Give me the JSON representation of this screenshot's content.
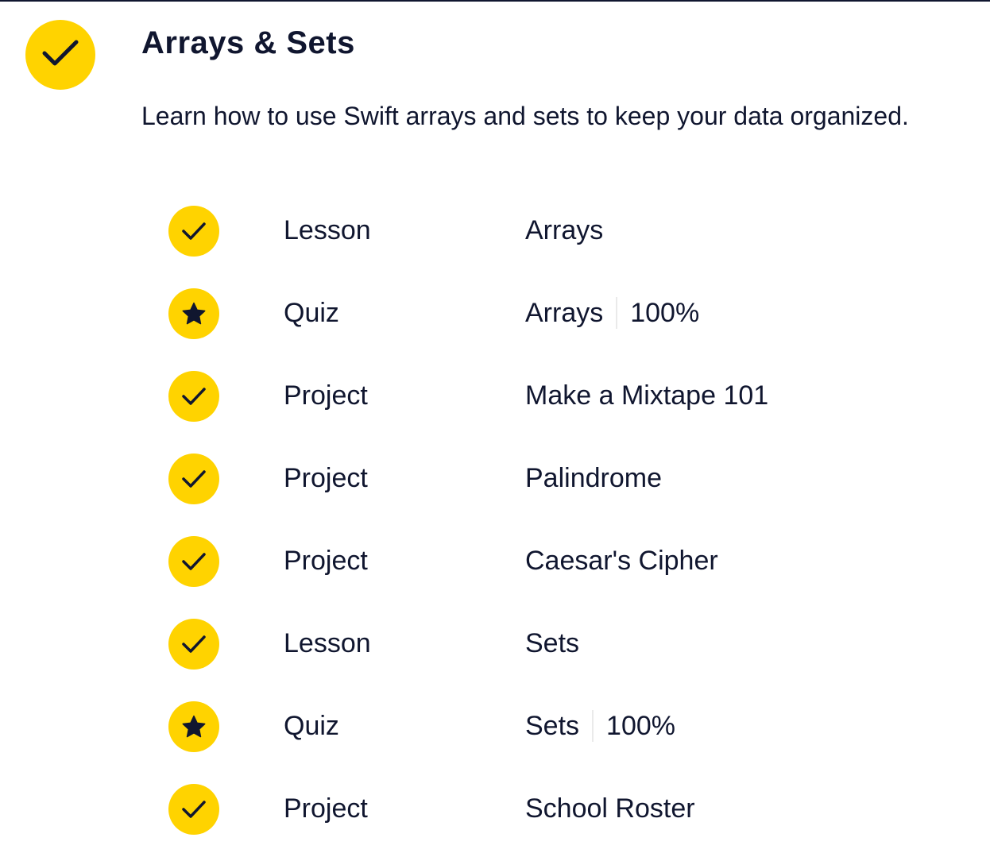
{
  "module": {
    "title": "Arrays & Sets",
    "description": "Learn how to use Swift arrays and sets to keep your data organized.",
    "status_icon": "check-icon",
    "accent_color": "#ffd300",
    "text_color": "#10162f"
  },
  "items": [
    {
      "type": "Lesson",
      "name": "Arrays",
      "score": null,
      "icon": "check-icon"
    },
    {
      "type": "Quiz",
      "name": "Arrays",
      "score": "100%",
      "icon": "star-icon"
    },
    {
      "type": "Project",
      "name": "Make a Mixtape 101",
      "score": null,
      "icon": "check-icon"
    },
    {
      "type": "Project",
      "name": "Palindrome",
      "score": null,
      "icon": "check-icon"
    },
    {
      "type": "Project",
      "name": "Caesar's Cipher",
      "score": null,
      "icon": "check-icon"
    },
    {
      "type": "Lesson",
      "name": "Sets",
      "score": null,
      "icon": "check-icon"
    },
    {
      "type": "Quiz",
      "name": "Sets",
      "score": "100%",
      "icon": "star-icon"
    },
    {
      "type": "Project",
      "name": "School Roster",
      "score": null,
      "icon": "check-icon"
    }
  ]
}
